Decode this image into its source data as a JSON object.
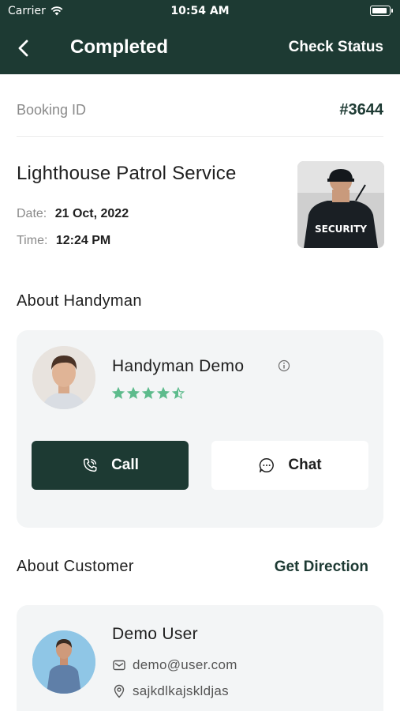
{
  "status_bar": {
    "carrier": "Carrier",
    "time": "10:54 AM"
  },
  "app_bar": {
    "title": "Completed",
    "action": "Check Status"
  },
  "booking": {
    "id_label": "Booking ID",
    "id_value": "#3644",
    "service_name": "Lighthouse Patrol Service",
    "date_label": "Date:",
    "date_value": "21 Oct, 2022",
    "time_label": "Time:",
    "time_value": "12:24 PM",
    "image_text": "SECURITY"
  },
  "handyman": {
    "section_title": "About Handyman",
    "name": "Handyman Demo",
    "rating": 4.5,
    "call_label": "Call",
    "chat_label": "Chat"
  },
  "customer": {
    "section_title": "About Customer",
    "direction_label": "Get Direction",
    "name": "Demo User",
    "email": "demo@user.com",
    "address": "sajkdlkajskldjas"
  },
  "colors": {
    "primary": "#1d3a33",
    "star": "#5dbb8c",
    "card_bg": "#f3f5f6",
    "muted_text": "#8a8a8a"
  }
}
